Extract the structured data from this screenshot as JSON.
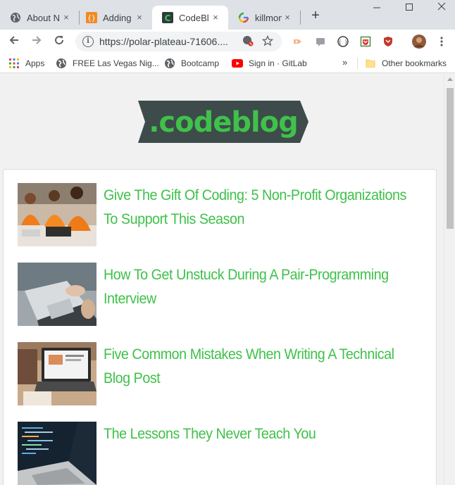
{
  "browser": {
    "tabs": [
      {
        "title": "About N",
        "favicon": "globe-icon"
      },
      {
        "title": "Adding",
        "favicon": "orange-braces-icon"
      },
      {
        "title": "CodeBl",
        "favicon": "codeblog-c-icon"
      },
      {
        "title": "killmon",
        "favicon": "google-g-icon"
      }
    ],
    "active_tab": 2,
    "close_glyph": "×",
    "new_tab_glyph": "+",
    "url": "https://polar-plateau-71606....",
    "bookmarks": [
      {
        "label": "Apps",
        "icon": "apps-grid-icon"
      },
      {
        "label": "FREE Las Vegas Nig...",
        "icon": "globe-icon"
      },
      {
        "label": "Bootcamp",
        "icon": "globe-icon"
      },
      {
        "label": "Sign in · GitLab",
        "icon": "youtube-icon"
      }
    ],
    "other_bookmarks": "Other bookmarks",
    "overflow_glyph": "»"
  },
  "site": {
    "logo_text": ".codeblog",
    "colors": {
      "accent": "#3fc14a",
      "logo_bg": "#3d4b4b"
    }
  },
  "posts": [
    {
      "title": "Give The Gift Of Coding: 5 Non-Profit Organizations To Support This Season"
    },
    {
      "title": "How To Get Unstuck During A Pair-Programming Interview"
    },
    {
      "title": "Five Common Mistakes When Writing A Technical Blog Post"
    },
    {
      "title": "The Lessons They Never Teach You"
    }
  ]
}
